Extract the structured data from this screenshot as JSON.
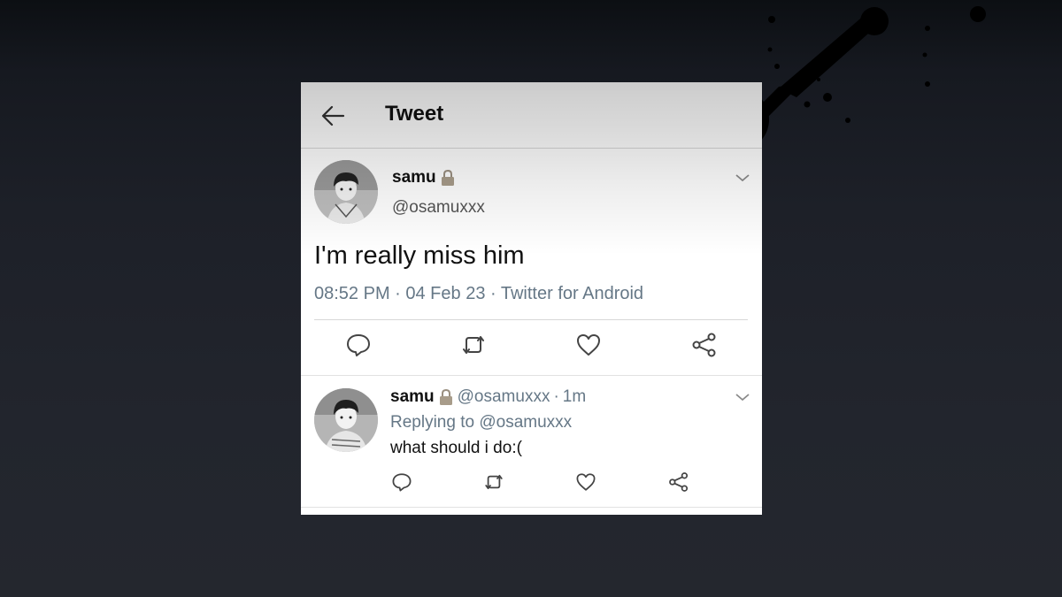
{
  "header": {
    "title": "Tweet"
  },
  "main_tweet": {
    "name": "samu",
    "handle": "@osamuxxx",
    "text": "I'm really miss him",
    "meta": "08:52 PM · 04 Feb 23 · Twitter for Android"
  },
  "reply": {
    "name": "samu",
    "handle": "@osamuxxx",
    "separator": "·",
    "time": "1m",
    "replying_to": "Replying to @osamuxxx",
    "text": "what should i do:("
  },
  "icons": [
    "back-arrow-icon",
    "lock-icon",
    "chevron-down-icon",
    "reply-icon",
    "retweet-icon",
    "like-icon",
    "share-icon"
  ],
  "colors": {
    "secondary_text": "#657786",
    "primary_text": "#111111",
    "divider": "#d8d8d8"
  }
}
